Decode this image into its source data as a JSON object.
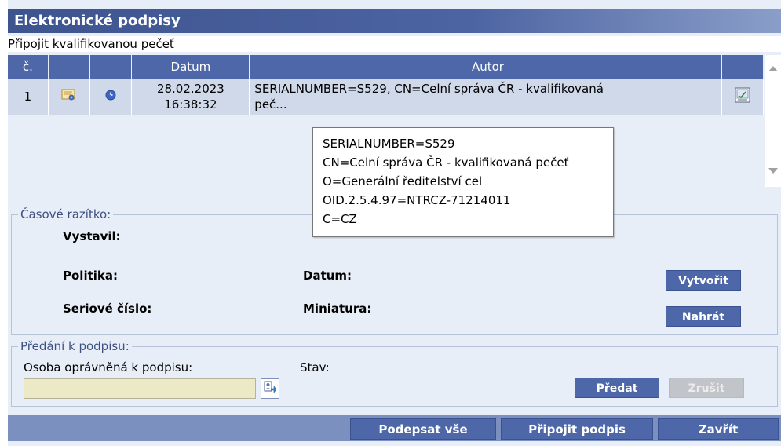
{
  "window": {
    "title": "Elektronické podpisy"
  },
  "link_attach_seal": "Připojit kvalifikovanou pečeť",
  "table": {
    "headers": {
      "num": "č.",
      "date": "Datum",
      "author": "Autor"
    },
    "rows": [
      {
        "num": "1",
        "date": "28.02.2023 16:38:32",
        "date_line1": "28.02.2023",
        "date_line2": "16:38:32",
        "author": "SERIALNUMBER=S529, CN=Celní správa ČR - kvalifikovaná peč...",
        "author_line1": "SERIALNUMBER=S529, CN=Celní správa ČR - kvalifikovaná",
        "author_line2": "peč..."
      }
    ]
  },
  "tooltip": {
    "lines": [
      "SERIALNUMBER=S529",
      "CN=Celní správa ČR - kvalifikovaná pečeť",
      "O=Generální ředitelství cel",
      "OID.2.5.4.97=NTRCZ-71214011",
      "C=CZ"
    ]
  },
  "timestamp": {
    "legend": "Časové razítko:",
    "issued_by": "Vystavil:",
    "policy": "Politika:",
    "date": "Datum:",
    "serial": "Seriové číslo:",
    "thumbnail": "Miniatura:",
    "create_btn": "Vytvořit",
    "upload_btn": "Nahrát"
  },
  "handover": {
    "legend": "Předání k podpisu:",
    "person_label": "Osoba oprávněná k podpisu:",
    "person_value": "",
    "state_label": "Stav:",
    "submit_btn": "Předat",
    "cancel_btn": "Zrušit"
  },
  "footer": {
    "sign_all": "Podepsat vše",
    "attach_sig": "Připojit podpis",
    "close": "Zavřít"
  },
  "colors": {
    "accent": "#4d67a8",
    "row_bg": "#cfd9ea",
    "panel_bg": "#e8eef7"
  }
}
